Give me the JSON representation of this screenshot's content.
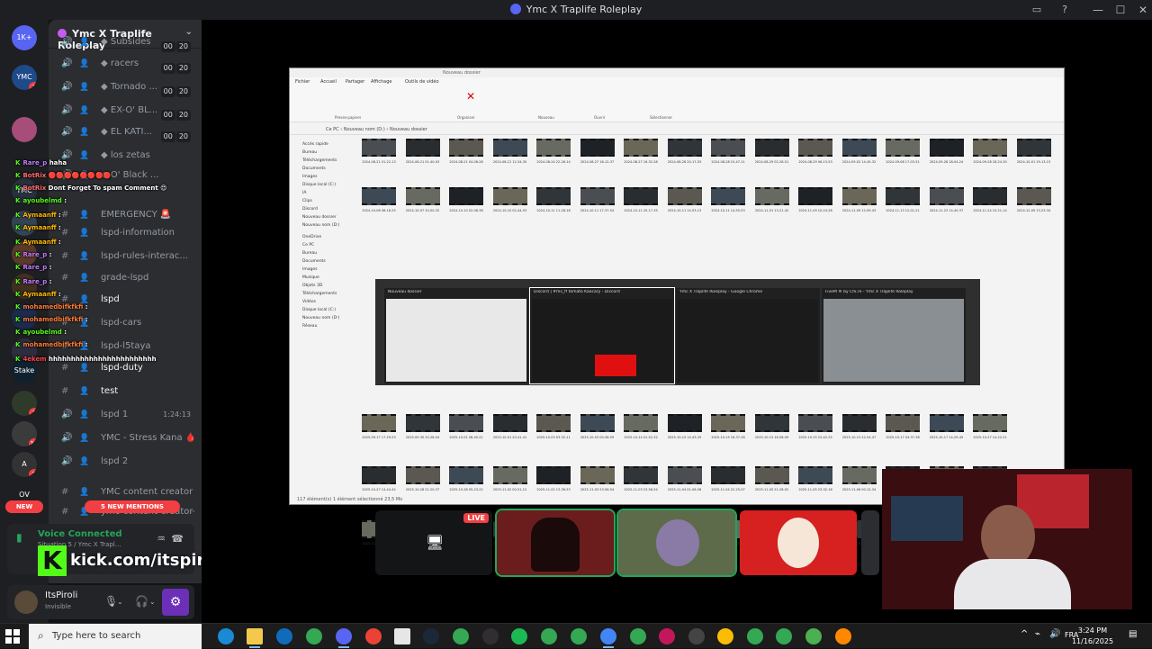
{
  "window": {
    "title": "Ymc X Traplife Roleplay",
    "controls": [
      "—",
      "☐",
      "✕"
    ]
  },
  "guilds": [
    {
      "label": "1K+",
      "color": "#5865f2"
    },
    {
      "label": "YMC",
      "color": "#1e4a8a",
      "badge": "1"
    },
    {
      "label": "",
      "color": "#a64d79"
    },
    {
      "label": "YMC",
      "color": "#27303d"
    },
    {
      "label": "",
      "color": "#334455"
    },
    {
      "label": "",
      "color": "#5a3a2a"
    },
    {
      "label": "",
      "color": "#403020"
    },
    {
      "label": "",
      "color": "#1b2a4d"
    },
    {
      "label": "",
      "color": "#2d2d40"
    },
    {
      "label": "Stake",
      "color": "#0f212e"
    },
    {
      "label": "",
      "color": "#2e3a2a",
      "badge": "1"
    },
    {
      "label": "",
      "color": "#3b3b3b",
      "badge": "12"
    },
    {
      "label": "A",
      "color": "#333333",
      "badge": "2"
    },
    {
      "label": "OV",
      "color": "#1e1f22"
    }
  ],
  "new_pill": "NEW",
  "server": {
    "name": "Ymc X Traplife Roleplay",
    "channels": [
      {
        "name": "◆ Subsides",
        "counts": [
          "00",
          "20"
        ]
      },
      {
        "name": "◆ racers",
        "counts": [
          "00",
          "20"
        ]
      },
      {
        "name": "◆ Tornado ...",
        "counts": [
          "00",
          "20"
        ]
      },
      {
        "name": "◆ EX-O' BL...",
        "counts": [
          "00",
          "20"
        ]
      },
      {
        "name": "◆ EL KATI...",
        "counts": [
          "00",
          "20"
        ]
      },
      {
        "name": "◆ los zetas",
        "counts": []
      },
      {
        "name": "◆ O' Black ...",
        "counts": []
      },
      {
        "name": "EMERGENCY 🚨",
        "counts": []
      },
      {
        "name": "lspd-information",
        "counts": []
      },
      {
        "name": "lspd-rules-interac...",
        "counts": []
      },
      {
        "name": "grade-lspd",
        "counts": []
      },
      {
        "name": "lspd",
        "counts": []
      },
      {
        "name": "lspd-cars",
        "counts": []
      },
      {
        "name": "lspd-l5taya",
        "counts": []
      },
      {
        "name": "lspd-duty",
        "counts": []
      },
      {
        "name": "test",
        "counts": []
      },
      {
        "name": "lspd 1",
        "time": "1:24:13"
      },
      {
        "name": "YMC - Stress Kana 🩸 YM",
        "counts": []
      },
      {
        "name": "lspd 2",
        "counts": []
      },
      {
        "name": "YMC content creator 📷",
        "counts": []
      },
      {
        "name": "ymc-content-creator-func...",
        "counts": []
      }
    ],
    "mentions_badge": "5 NEW MENTIONS"
  },
  "chat": [
    {
      "user": "Rare_p",
      "color": "#c07cff",
      "msg": "haha"
    },
    {
      "user": "BotRix",
      "color": "#ff6b6b",
      "msg": "🔴🔴🔴🔴🔴🔴🔴🔴"
    },
    {
      "user": "BotRix",
      "color": "#ff6b6b",
      "msg": "Dont Forget To spam Comment 😍"
    },
    {
      "user": "ayoubelmd",
      "color": "#53fc18",
      "msg": ":"
    },
    {
      "user": "Aymaanff",
      "color": "#ffb800",
      "msg": ":"
    },
    {
      "user": "Aymaanff",
      "color": "#ffb800",
      "msg": ":"
    },
    {
      "user": "Aymaanff",
      "color": "#ffb800",
      "msg": ":"
    },
    {
      "user": "Rare_p",
      "color": "#c07cff",
      "msg": ":"
    },
    {
      "user": "Rare_p",
      "color": "#c07cff",
      "msg": ":"
    },
    {
      "user": "Rare_p",
      "color": "#c07cff",
      "msg": ":"
    },
    {
      "user": "Aymaanff",
      "color": "#ffb800",
      "msg": ":"
    },
    {
      "user": "mohamedbifkfkfi",
      "color": "#ff7a33",
      "msg": ":"
    },
    {
      "user": "mohamedbifkfkfi",
      "color": "#ff7a33",
      "msg": ":"
    },
    {
      "user": "ayoubelmd",
      "color": "#53fc18",
      "msg": ":"
    },
    {
      "user": "mohamedbifkfkfi",
      "color": "#ff7a33",
      "msg": ":"
    },
    {
      "user": "4ekem",
      "color": "#ff4444",
      "msg": "hhhhhhhhhhhhhhhhhhhhhhhh"
    }
  ],
  "voice": {
    "status": "Voice Connected",
    "channel": "Situation 5 / Ymc X Trapl..."
  },
  "kick": {
    "logo": "K",
    "url": "kick.com/itspiroli"
  },
  "user": {
    "name": "ItsPiroli",
    "status": "Invisible"
  },
  "explorer": {
    "title": "Nouveau dossier",
    "tabs": [
      "Fichier",
      "Accueil",
      "Partager",
      "Affichage",
      "Outils de vidéo"
    ],
    "groups": [
      "Presse-papiers",
      "Organiser",
      "Nouveau",
      "Ouvrir",
      "Sélectionner"
    ],
    "path": "Ce PC  ›  Nouveau nom (D:)  ›  Nouveau dossier",
    "nav": [
      "Accès rapide",
      "Bureau",
      "Téléchargements",
      "Documents",
      "Images",
      "Disque local (C:)",
      "IA",
      "Clips",
      "Discord",
      "Nouveau dossier",
      "Nouveau nom (D:)",
      "OneDrive",
      "Ce PC",
      "Bureau",
      "Documents",
      "Images",
      "Musique",
      "Objets 3D",
      "Téléchargements",
      "Vidéos",
      "Disque local (C:)",
      "Nouveau nom (D:)",
      "Réseau"
    ],
    "thumb_rows": [
      [
        "2024-08-21 01-22-13",
        "2024-08-21 01-40-03",
        "2024-08-21 04-06-28",
        "2024-08-21 12-34-30",
        "2024-08-24 22-26-14",
        "2024-08-27 16-12-37",
        "2024-08-27 16-32-28",
        "2024-08-28 20-17-53",
        "2024-08-28 15-47-11",
        "2024-08-29 02-28-51",
        "2024-08-29 06-13-53",
        "2024-09-02 14-45-32",
        "2024-09-08 17-03-51",
        "2024-09-28 18-04-24",
        "2024-09-28 18-24-30",
        "2024-10-01 19-13-13"
      ],
      [
        "2024-10-06 06-16-25",
        "2024-10-07 20-00-32",
        "2024-10-10 02-08-38",
        "2024-10-10 02-44-53",
        "2024-10-11 11-28-18",
        "2024-10-11 17-37-54",
        "2024-10-11 20-17-35",
        "2024-10-11 14-53-13",
        "2024-10-11 14-55-53",
        "2024-11-01 13-21-42",
        "2024-11-09 10-24-28",
        "2024-11-09 12-09-43",
        "2024-11-13 12-01-21",
        "2024-11-23 14-40-37",
        "2024-11-24 10-21-14",
        "2024-12-09 13-23-34"
      ],
      [
        "2025-09-17 17-29-53",
        "2025-09-30 20-28-04",
        "2025-10-01 06-40-21",
        "2025-10-01 20-41-41",
        "2025-10-03 03-32-11",
        "2025-10-03 00-58-59",
        "2025-10-14 01-52-32",
        "2025-10-15 14-43-25",
        "2025-10-15 16-37-28",
        "2025-10-15 16-58-09",
        "2025-10-15 23-42-25",
        "2025-10-15 22-54-47",
        "2025-10-17 04-37-36",
        "2025-10-17 14-29-45",
        "2025-10-27 14-22-21"
      ],
      [
        "2025-10-27 14-44-42",
        "2025-10-28 21-20-37",
        "2025-10-28 05-23-22",
        "2025-11-02 00-51-12",
        "2025-11-02 13-36-53",
        "2025-11-03 23-56-54",
        "2025-11-03 23-56-54",
        "2025-11-04 01-06-56",
        "2025-11-04 22-25-07",
        "2025-11-05 21-28-02",
        "2025-11-05 23-32-18",
        "2025-11-06 00-12-34",
        "2025-11-07 02-25-41",
        "2025-11-07 02-55-37",
        "2025-11-08 03-45-54"
      ],
      [
        "2025-11-11 16-14-14",
        "2025-11-12 16-58-44",
        "2025-11-12 23-51-04",
        "2025-11-13 00-37-44",
        "2025-11-15 00-44-04",
        "2025-11-15 21-08-08",
        "2025-11-15 10-44-14",
        "2025-11-15 16-29-21",
        "2025-11-16 02-02-14",
        "2025-11-16 03-13-21",
        "2025-11-16 23-43-30",
        "2025-11-16 23-43-30"
      ]
    ],
    "status": "117 élément(s)   1 élément sélectionné 23,5 Mo"
  },
  "alt_tab": [
    {
      "caption": "Nouveau dossier",
      "preview": "#e8e8e8"
    },
    {
      "caption": "Discord | #ms_ff tomato Kaocary - Discord",
      "preview": "#1a1a1a"
    },
    {
      "caption": "Ymc X Traplife Roleplay - Google Chrome",
      "preview": "#1b1b1b"
    },
    {
      "caption": "FiveM ® by Cfx.re - Ymc X Traplife Roleplay",
      "preview": "#8a8f94"
    }
  ],
  "stream_tiles": {
    "live_label": "LIVE"
  },
  "taskbar": {
    "search_placeholder": "Type here to search",
    "lang": "FRA",
    "time": "3:24 PM",
    "date": "11/16/2025"
  },
  "colors": {
    "discord_blurple": "#5865f2",
    "kick_green": "#53fc18",
    "live_red": "#f23f43",
    "speaking_green": "#23a55a"
  }
}
